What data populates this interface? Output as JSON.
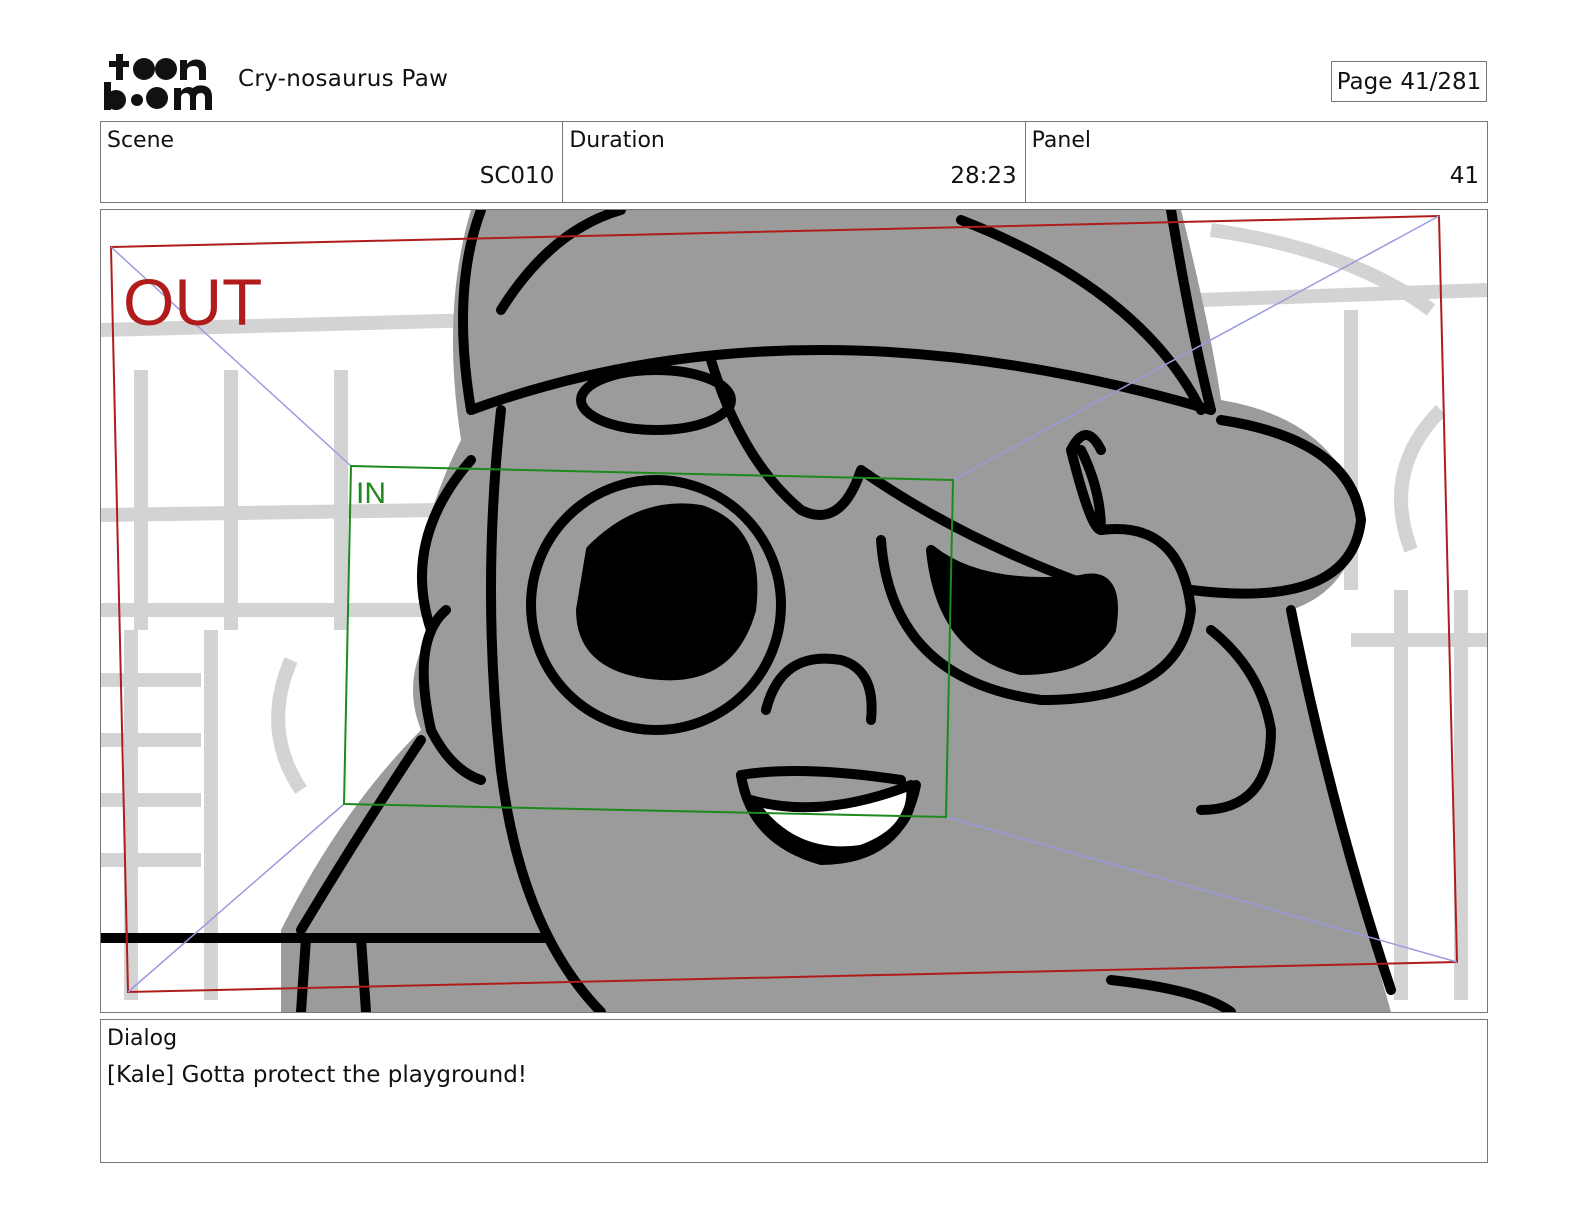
{
  "header": {
    "logo_text": "toonboom",
    "project_title": "Cry-nosaurus Paw",
    "page_label": "Page",
    "page_value": "41/281"
  },
  "info": {
    "scene_label": "Scene",
    "scene_value": "SC010",
    "duration_label": "Duration",
    "duration_value": "28:23",
    "panel_label": "Panel",
    "panel_value": "41"
  },
  "panel": {
    "out_label": "OUT",
    "in_label": "IN",
    "out_color": "#b01c1c",
    "in_color": "#1e8a1e",
    "guide_color": "#9a9ae0"
  },
  "dialog": {
    "label": "Dialog",
    "text": "[Kale] Gotta protect the playground!"
  }
}
